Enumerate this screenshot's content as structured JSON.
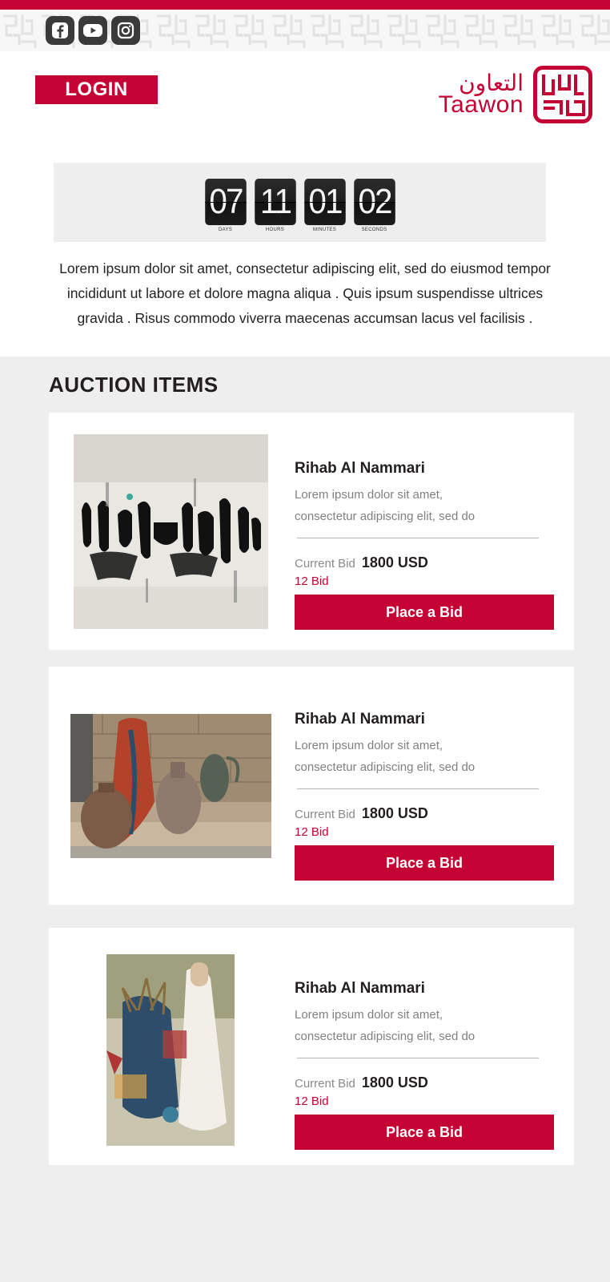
{
  "header": {
    "social": [
      {
        "name": "facebook-icon"
      },
      {
        "name": "youtube-icon"
      },
      {
        "name": "instagram-icon"
      }
    ],
    "login_label": "LOGIN",
    "logo_arabic": "التعاون",
    "logo_english": "Taawon"
  },
  "countdown": {
    "units": [
      {
        "value": "07",
        "label": "DAYS"
      },
      {
        "value": "11",
        "label": "HOURS"
      },
      {
        "value": "01",
        "label": "MINUTES"
      },
      {
        "value": "02",
        "label": "SECONDS"
      }
    ]
  },
  "intro": "Lorem ipsum dolor sit amet, consectetur adipiscing elit, sed do eiusmod tempor incididunt ut labore et dolore magna aliqua . Quis ipsum suspendisse ultrices gravida . Risus commodo viverra maecenas accumsan lacus vel facilisis .",
  "section_title": "AUCTION ITEMS",
  "items": [
    {
      "artist": "Rihab Al Nammari",
      "desc_line1": "Lorem ipsum dolor sit amet,",
      "desc_line2": "consectetur adipiscing elit, sed do",
      "bid_label": "Current Bid",
      "bid_value": "1800 USD",
      "bid_count": "12 Bid",
      "button": "Place a Bid"
    },
    {
      "artist": "Rihab Al Nammari",
      "desc_line1": "Lorem ipsum dolor sit amet,",
      "desc_line2": "consectetur adipiscing elit, sed do",
      "bid_label": "Current Bid",
      "bid_value": "1800 USD",
      "bid_count": "12 Bid",
      "button": "Place a Bid"
    },
    {
      "artist": "Rihab Al Nammari",
      "desc_line1": "Lorem ipsum dolor sit amet,",
      "desc_line2": "consectetur adipiscing elit, sed do",
      "bid_label": "Current Bid",
      "bid_value": "1800 USD",
      "bid_count": "12 Bid",
      "button": "Place a Bid"
    }
  ],
  "colors": {
    "brand": "#c40233",
    "background": "#eeeeee"
  }
}
